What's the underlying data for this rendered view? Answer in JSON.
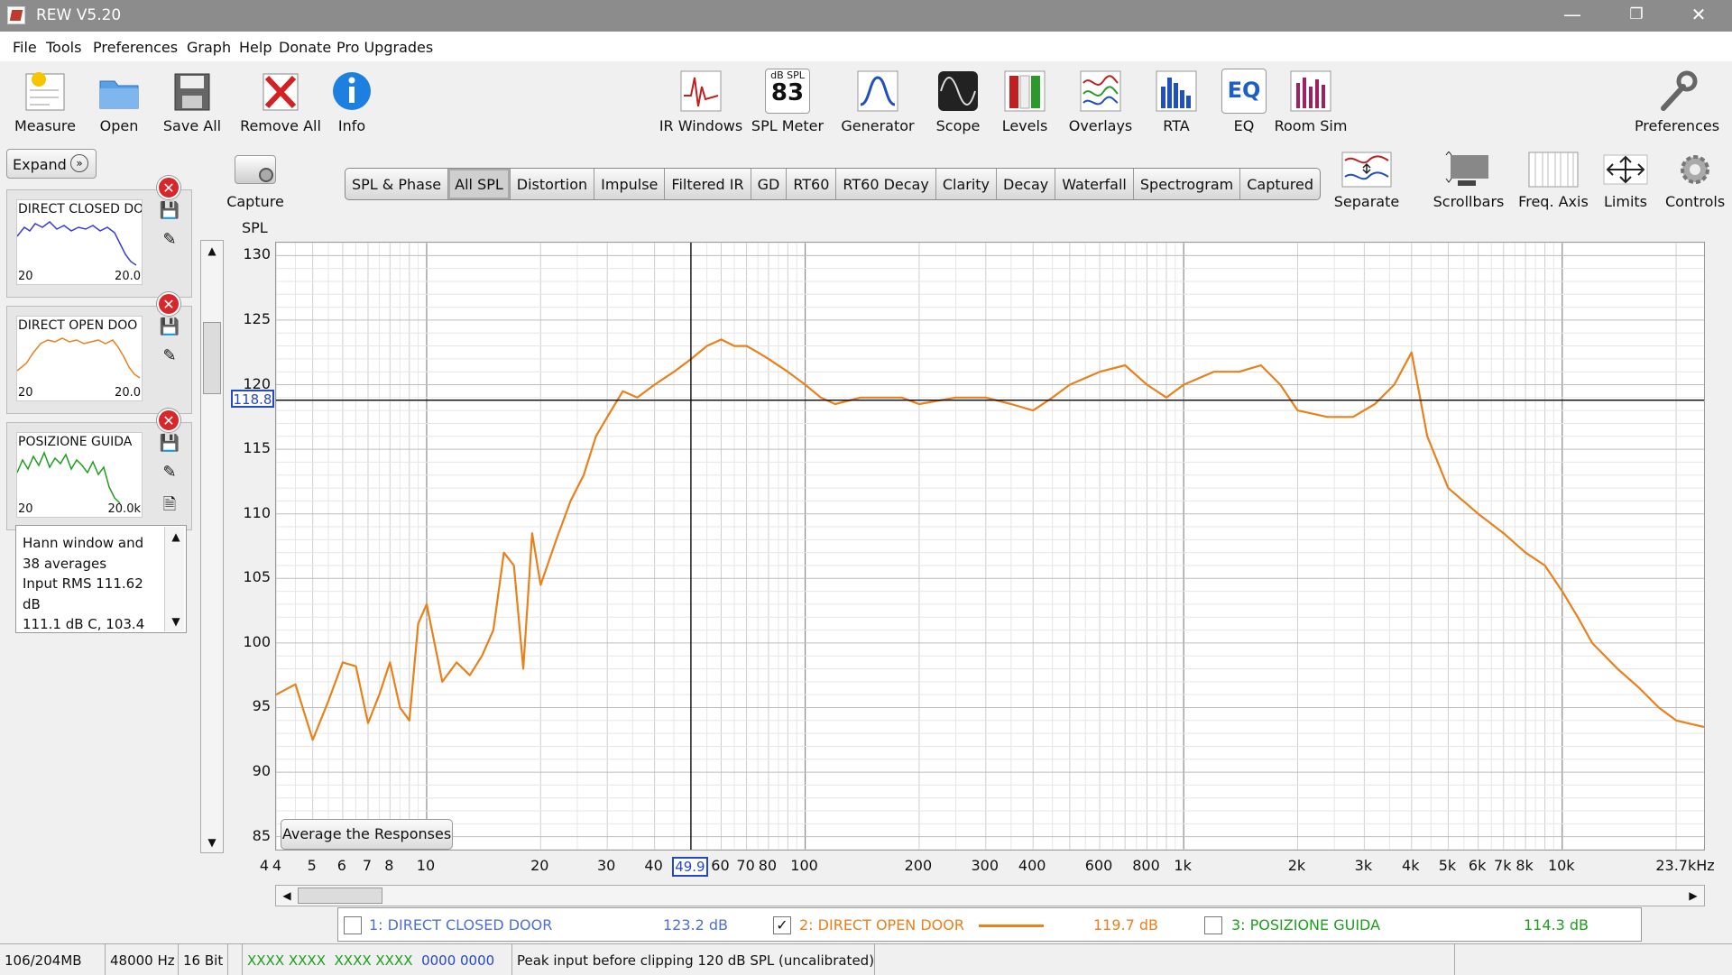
{
  "window": {
    "title": "REW V5.20",
    "controls": {
      "minimize": "—",
      "restore": "❐",
      "close": "✕"
    }
  },
  "menu": [
    "File",
    "Tools",
    "Preferences",
    "Graph",
    "Help",
    "Donate",
    "Pro Upgrades"
  ],
  "toolbar": {
    "left": [
      "Measure",
      "Open",
      "Save All",
      "Remove All",
      "Info"
    ],
    "center": [
      "IR Windows",
      "SPL Meter",
      "Generator",
      "Scope",
      "Levels",
      "Overlays",
      "RTA",
      "EQ",
      "Room Sim"
    ],
    "right": "Preferences",
    "spl_meter": {
      "unit": "dB SPL",
      "value": "83"
    },
    "eq_text": "EQ"
  },
  "left_panel": {
    "expand_label": "Expand",
    "expand_icon": "chevron-double-right",
    "measurements": [
      {
        "name": "DIRECT CLOSED DO",
        "min": "20",
        "max": "20.0",
        "color": "#3b3bd4"
      },
      {
        "name": "DIRECT OPEN DOO",
        "min": "20",
        "max": "20.0",
        "color": "#e8811c"
      },
      {
        "name": "POSIZIONE GUIDA",
        "min": "20",
        "max": "20.0k",
        "color": "#1e9e1e"
      }
    ],
    "notes": [
      "Hann window and",
      "38 averages",
      "Input RMS 111.62",
      "dB",
      "111.1 dB C, 103.4"
    ]
  },
  "capture_label": "Capture",
  "tabs": [
    {
      "label": "SPL & Phase",
      "selected": false
    },
    {
      "label": "All SPL",
      "selected": true
    },
    {
      "label": "Distortion",
      "selected": false
    },
    {
      "label": "Impulse",
      "selected": false
    },
    {
      "label": "Filtered IR",
      "selected": false
    },
    {
      "label": "GD",
      "selected": false
    },
    {
      "label": "RT60",
      "selected": false
    },
    {
      "label": "RT60 Decay",
      "selected": false
    },
    {
      "label": "Clarity",
      "selected": false
    },
    {
      "label": "Decay",
      "selected": false
    },
    {
      "label": "Waterfall",
      "selected": false
    },
    {
      "label": "Spectrogram",
      "selected": false
    },
    {
      "label": "Captured",
      "selected": false
    }
  ],
  "graph_controls": [
    "Separate",
    "Scrollbars",
    "Freq. Axis",
    "Limits",
    "Controls"
  ],
  "graph": {
    "ylabel": "SPL",
    "cursor_y": "118.8",
    "cursor_x": "49.9",
    "average_button": "Average the Responses",
    "legend": [
      {
        "label": "1: DIRECT CLOSED DOOR",
        "value": "123.2 dB",
        "checked": false,
        "color": "#4f6fd8"
      },
      {
        "label": "2: DIRECT OPEN DOOR",
        "value": "119.7 dB",
        "checked": true,
        "color": "#e8811c"
      },
      {
        "label": "3: POSIZIONE GUIDA",
        "value": "114.3 dB",
        "checked": false,
        "color": "#1e9e1e"
      }
    ]
  },
  "chart_data": {
    "type": "line",
    "title": "",
    "xlabel": "",
    "ylabel": "SPL",
    "x_scale": "log",
    "xlim": [
      4,
      23700
    ],
    "ylim": [
      84,
      131
    ],
    "y_ticks": [
      130,
      125,
      120,
      115,
      110,
      105,
      100,
      95,
      90,
      85
    ],
    "x_ticks": [
      "4",
      "5",
      "6",
      "7",
      "8",
      "10",
      "20",
      "30",
      "40",
      "60",
      "70",
      "80",
      "100",
      "200",
      "300",
      "400",
      "600",
      "800",
      "1k",
      "2k",
      "3k",
      "4k",
      "5k",
      "6k",
      "7k",
      "8k",
      "10k",
      "23.7kHz"
    ],
    "x_tick_values": [
      4,
      5,
      6,
      7,
      8,
      10,
      20,
      30,
      40,
      60,
      70,
      80,
      100,
      200,
      300,
      400,
      600,
      800,
      1000,
      2000,
      3000,
      4000,
      5000,
      6000,
      7000,
      8000,
      10000,
      23700
    ],
    "extra_left_tick": "4",
    "grid": true,
    "series": [
      {
        "name": "2: DIRECT OPEN DOOR",
        "color": "#e8811c",
        "x": [
          4,
          4.5,
          5,
          5.5,
          6,
          6.5,
          7,
          7.5,
          8,
          8.5,
          9,
          9.5,
          10,
          11,
          12,
          13,
          14,
          15,
          16,
          17,
          18,
          19,
          20,
          22,
          24,
          26,
          28,
          30,
          33,
          36,
          40,
          45,
          50,
          55,
          60,
          65,
          70,
          75,
          80,
          90,
          100,
          110,
          120,
          140,
          160,
          180,
          200,
          250,
          300,
          350,
          400,
          450,
          500,
          600,
          700,
          800,
          900,
          1000,
          1200,
          1400,
          1600,
          1800,
          2000,
          2400,
          2800,
          3200,
          3600,
          4000,
          4400,
          5000,
          6000,
          7000,
          8000,
          9000,
          10000,
          11000,
          12000,
          14000,
          16000,
          18000,
          20000,
          23700
        ],
        "y": [
          96,
          96.8,
          92.5,
          95.5,
          98.5,
          98.2,
          93.8,
          96,
          98.5,
          95,
          94,
          101.5,
          103,
          97,
          98.5,
          97.5,
          99,
          101,
          107,
          106,
          98,
          108.5,
          104.5,
          108,
          111,
          113,
          116,
          117.5,
          119.5,
          119,
          120,
          121,
          122,
          123,
          123.5,
          123,
          123,
          122.5,
          122,
          121,
          120,
          119,
          118.5,
          119,
          119,
          119,
          118.5,
          119,
          119,
          118.5,
          118,
          119,
          120,
          121,
          121.5,
          120,
          119,
          120,
          121,
          121,
          121.5,
          120,
          118,
          117.5,
          117.5,
          118.5,
          120,
          122.5,
          116,
          112,
          110,
          108.5,
          107,
          106,
          104,
          102,
          100,
          98,
          96.5,
          95,
          94,
          93.5
        ]
      }
    ]
  },
  "status": {
    "memory": "106/204MB",
    "rate": "48000 Hz",
    "bits": "16 Bit",
    "meters": [
      "XXXX XXXX",
      "XXXX XXXX",
      "0000 0000"
    ],
    "message": "Peak input before clipping 120 dB SPL (uncalibrated)"
  }
}
